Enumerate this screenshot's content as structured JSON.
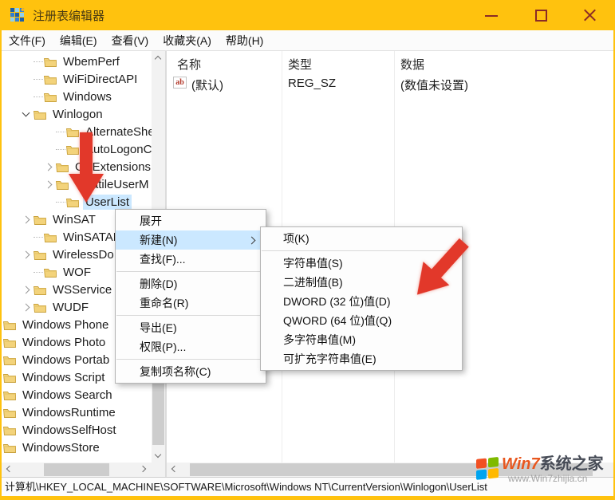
{
  "window": {
    "title": "注册表编辑器"
  },
  "titlebar_controls": {
    "minimize": "minimize",
    "maximize": "maximize",
    "close": "close"
  },
  "menubar": {
    "items": [
      "文件(F)",
      "编辑(E)",
      "查看(V)",
      "收藏夹(A)",
      "帮助(H)"
    ]
  },
  "tree": {
    "items": [
      {
        "label": "WbemPerf",
        "depth": 1,
        "chevron": "none"
      },
      {
        "label": "WiFiDirectAPI",
        "depth": 1,
        "chevron": "none"
      },
      {
        "label": "Windows",
        "depth": 1,
        "chevron": "none"
      },
      {
        "label": "Winlogon",
        "depth": 1,
        "chevron": "expanded"
      },
      {
        "label": "AlternateShel",
        "depth": 2,
        "chevron": "none"
      },
      {
        "label": "AutoLogonCh",
        "depth": 2,
        "chevron": "none"
      },
      {
        "label": "GPExtensions",
        "depth": 2,
        "chevron": "collapsed"
      },
      {
        "label": "VolatileUserM",
        "depth": 2,
        "chevron": "collapsed"
      },
      {
        "label": "UserList",
        "depth": 2,
        "chevron": "none",
        "selected": true
      },
      {
        "label": "WinSAT",
        "depth": 1,
        "chevron": "collapsed"
      },
      {
        "label": "WinSATAPI",
        "depth": 1,
        "chevron": "none"
      },
      {
        "label": "WirelessDo",
        "depth": 1,
        "chevron": "collapsed"
      },
      {
        "label": "WOF",
        "depth": 1,
        "chevron": "none"
      },
      {
        "label": "WSService",
        "depth": 1,
        "chevron": "collapsed"
      },
      {
        "label": "WUDF",
        "depth": 1,
        "chevron": "collapsed"
      },
      {
        "label": "Windows Phone",
        "depth": 0,
        "chevron": "none"
      },
      {
        "label": "Windows Photo",
        "depth": 0,
        "chevron": "none"
      },
      {
        "label": "Windows Portab",
        "depth": 0,
        "chevron": "none"
      },
      {
        "label": "Windows Script",
        "depth": 0,
        "chevron": "none"
      },
      {
        "label": "Windows Search",
        "depth": 0,
        "chevron": "none"
      },
      {
        "label": "WindowsRuntime",
        "depth": 0,
        "chevron": "none"
      },
      {
        "label": "WindowsSelfHost",
        "depth": 0,
        "chevron": "none"
      },
      {
        "label": "WindowsStore",
        "depth": 0,
        "chevron": "none"
      }
    ]
  },
  "list": {
    "columns": [
      "名称",
      "类型",
      "数据"
    ],
    "rows": [
      {
        "icon": "string-value-icon",
        "icon_label": "ab",
        "name": "(默认)",
        "type": "REG_SZ",
        "data": "(数值未设置)"
      }
    ]
  },
  "context_menu": {
    "items": [
      {
        "name": "expand",
        "label": "展开"
      },
      {
        "name": "new",
        "label": "新建(N)",
        "highlighted": true,
        "has_submenu": true
      },
      {
        "name": "find",
        "label": "查找(F)..."
      },
      {
        "separator": true
      },
      {
        "name": "delete",
        "label": "删除(D)"
      },
      {
        "name": "rename",
        "label": "重命名(R)"
      },
      {
        "separator": true
      },
      {
        "name": "export",
        "label": "导出(E)"
      },
      {
        "name": "permissions",
        "label": "权限(P)..."
      },
      {
        "separator": true
      },
      {
        "name": "copy-key-name",
        "label": "复制项名称(C)"
      }
    ]
  },
  "submenu": {
    "items": [
      {
        "name": "key",
        "label": "项(K)"
      },
      {
        "separator": true
      },
      {
        "name": "string-value",
        "label": "字符串值(S)"
      },
      {
        "name": "binary-value",
        "label": "二进制值(B)"
      },
      {
        "name": "dword-32-value",
        "label": "DWORD (32 位)值(D)"
      },
      {
        "name": "qword-64-value",
        "label": "QWORD (64 位)值(Q)"
      },
      {
        "name": "multi-string-value",
        "label": "多字符串值(M)"
      },
      {
        "name": "expandable-string-value",
        "label": "可扩充字符串值(E)"
      }
    ]
  },
  "statusbar": {
    "path": "计算机\\HKEY_LOCAL_MACHINE\\SOFTWARE\\Microsoft\\Windows NT\\CurrentVersion\\Winlogon\\UserList"
  },
  "watermark": {
    "brand_prefix": "Win7",
    "brand_suffix": "系统之家",
    "url": "www.Win7zhijia.cn"
  },
  "colors": {
    "titlebar": "#FFC20E",
    "control": "#8B2B26",
    "selection": "#CBE8FF",
    "red_arrow": "#E2382A",
    "folder_fill": "#F3D37B",
    "folder_edge": "#C9A23D"
  }
}
